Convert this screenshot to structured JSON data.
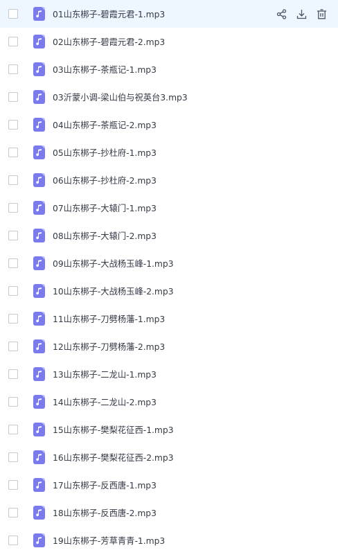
{
  "files": [
    {
      "name": "01山东梆子-碧霞元君-1.mp3",
      "hovered": true
    },
    {
      "name": "02山东梆子-碧霞元君-2.mp3"
    },
    {
      "name": "03山东梆子-茶瓶记-1.mp3"
    },
    {
      "name": "03沂蒙小调-梁山伯与祝英台3.mp3"
    },
    {
      "name": "04山东梆子-茶瓶记-2.mp3"
    },
    {
      "name": "05山东梆子-抄杜府-1.mp3"
    },
    {
      "name": "06山东梆子-抄杜府-2.mp3"
    },
    {
      "name": "07山东梆子-大辕门-1.mp3"
    },
    {
      "name": "08山东梆子-大辕门-2.mp3"
    },
    {
      "name": "09山东梆子-大战杨玉峰-1.mp3"
    },
    {
      "name": "10山东梆子-大战杨玉峰-2.mp3"
    },
    {
      "name": "11山东梆子-刀劈杨藩-1.mp3"
    },
    {
      "name": "12山东梆子-刀劈杨藩-2.mp3"
    },
    {
      "name": "13山东梆子-二龙山-1.mp3"
    },
    {
      "name": "14山东梆子-二龙山-2.mp3"
    },
    {
      "name": "15山东梆子-樊梨花征西-1.mp3"
    },
    {
      "name": "16山东梆子-樊梨花征西-2.mp3"
    },
    {
      "name": "17山东梆子-反西唐-1.mp3"
    },
    {
      "name": "18山东梆子-反西唐-2.mp3"
    },
    {
      "name": "19山东梆子-芳草青青-1.mp3"
    }
  ],
  "row_actions": [
    {
      "name": "share-icon"
    },
    {
      "name": "download-icon"
    },
    {
      "name": "delete-icon"
    }
  ],
  "colors": {
    "hover_background": "#eef6ff",
    "audio_icon": "#7b7bf0",
    "text": "#333a46",
    "action_icon": "#4a5160"
  }
}
